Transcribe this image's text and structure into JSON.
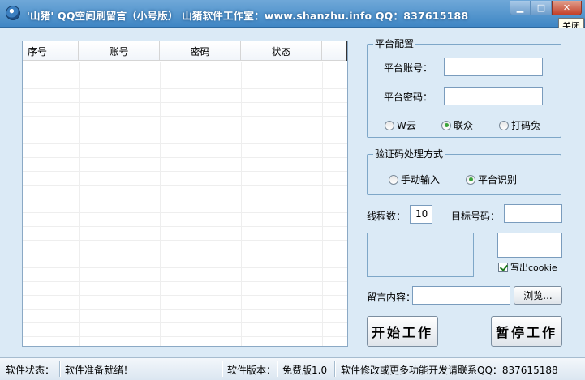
{
  "window": {
    "title": "'山猪' QQ空间刷留言（小号版） 山猪软件工作室：www.shanzhu.info  QQ：837615188",
    "min_glyph": "▁",
    "max_glyph": "□",
    "close_glyph": "✕",
    "close_tooltip": "关闭"
  },
  "listview": {
    "columns": [
      "序号",
      "账号",
      "密码",
      "状态"
    ]
  },
  "platform_group": {
    "title": "平台配置",
    "account_label": "平台账号：",
    "account_value": "",
    "password_label": "平台密码：",
    "password_value": "",
    "options": [
      {
        "label": "W云",
        "selected": false
      },
      {
        "label": "联众",
        "selected": true
      },
      {
        "label": "打码兔",
        "selected": false
      }
    ]
  },
  "captcha_group": {
    "title": "验证码处理方式",
    "options": [
      {
        "label": "手动输入",
        "selected": false
      },
      {
        "label": "平台识别",
        "selected": true
      }
    ]
  },
  "threads": {
    "label": "线程数：",
    "value": "10"
  },
  "target": {
    "label": "目标号码：",
    "value": ""
  },
  "cookie": {
    "label": "写出cookie",
    "checked": true
  },
  "message": {
    "label": "留言内容：",
    "value": "",
    "browse_label": "浏览..."
  },
  "buttons": {
    "start": "开始工作",
    "pause": "暂停工作"
  },
  "statusbar": {
    "state_label": "软件状态：",
    "state_value": "软件准备就绪！",
    "version_label": "软件版本：",
    "version_value": "免费版1.0",
    "contact": "软件修改或更多功能开发请联系QQ：837615188"
  },
  "colors": {
    "titlebar": "#3f86c4",
    "client_bg": "#dbeaf6",
    "radio_selected": "#3aa33a"
  }
}
